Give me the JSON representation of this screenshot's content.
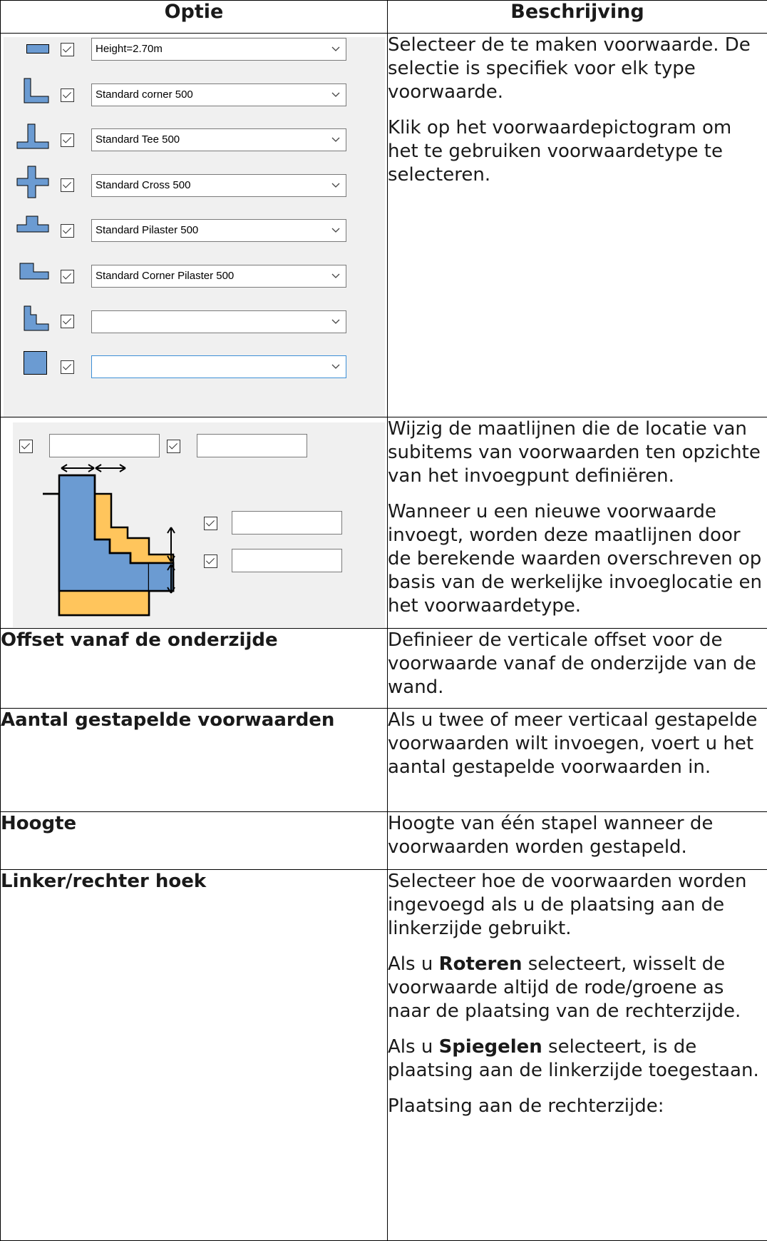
{
  "header": {
    "option": "Optie",
    "description": "Beschrijving"
  },
  "row1": {
    "items": [
      {
        "icon": "rectangle-icon",
        "value": "Height=2.70m"
      },
      {
        "icon": "corner-icon",
        "value": "Standard corner 500"
      },
      {
        "icon": "tee-icon",
        "value": "Standard Tee 500"
      },
      {
        "icon": "cross-icon",
        "value": "Standard Cross 500"
      },
      {
        "icon": "pilaster-icon",
        "value": "Standard Pilaster 500"
      },
      {
        "icon": "corner-pilaster-icon",
        "value": "Standard Corner Pilaster 500"
      },
      {
        "icon": "stepped-corner-icon",
        "value": ""
      },
      {
        "icon": "square-icon",
        "value": ""
      }
    ],
    "desc": [
      "Selecteer de te maken voorwaarde. De selectie is specifiek voor elk type voorwaarde.",
      "Klik op het voorwaardepictogram om het te gebruiken voorwaardetype te selecteren."
    ]
  },
  "row2": {
    "desc": [
      "Wijzig de maatlijnen die de locatie van subitems van voorwaarden ten opzichte van het invoegpunt definiëren.",
      "Wanneer u een nieuwe voorwaarde invoegt, worden deze maatlijnen door de berekende waarden overschreven op basis van de werkelijke invoeglocatie en het voorwaardetype."
    ]
  },
  "row3": {
    "option": "Offset vanaf de onderzijde",
    "desc": "Definieer de verticale offset voor de voorwaarde vanaf de onderzijde van de wand."
  },
  "row4": {
    "option": "Aantal gestapelde voorwaarden",
    "desc": "Als u twee of meer verticaal gestapelde voorwaarden wilt invoegen, voert u het aantal gestapelde voorwaarden in."
  },
  "row5": {
    "option": "Hoogte",
    "desc": "Hoogte van één stapel wanneer de voorwaarden worden gestapeld."
  },
  "row6": {
    "option": "Linker/rechter hoek",
    "p1": "Selecteer hoe de voorwaarden worden ingevoegd als u de plaatsing aan de linkerzijde gebruikt.",
    "p2_pre": "Als u ",
    "p2_bold": "Roteren",
    "p2_post": " selecteert, wisselt de voorwaarde altijd de rode/groene as naar de plaatsing van de rechterzijde.",
    "p3_pre": "Als u ",
    "p3_bold": "Spiegelen",
    "p3_post": " selecteert, is de plaatsing aan de linkerzijde toegestaan.",
    "p4": "Plaatsing aan de rechterzijde:"
  },
  "colors": {
    "fill_blue": "#6b9bd2",
    "fill_orange": "#ffc55c",
    "outline": "#000000",
    "panel": "#f0f0f0"
  }
}
